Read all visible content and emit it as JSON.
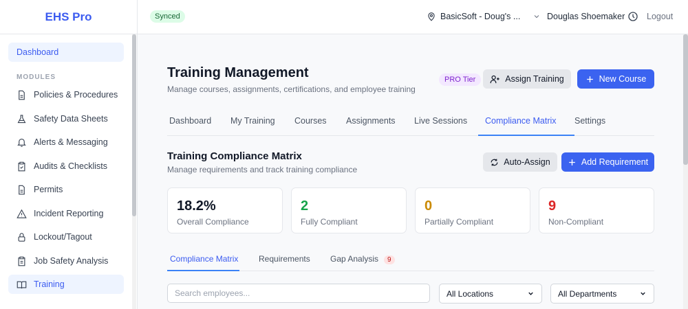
{
  "sidebar": {
    "logo": "EHS Pro",
    "dashboard": "Dashboard",
    "modules_label": "MODULES",
    "items": [
      {
        "label": "Policies & Procedures"
      },
      {
        "label": "Safety Data Sheets"
      },
      {
        "label": "Alerts & Messaging"
      },
      {
        "label": "Audits & Checklists"
      },
      {
        "label": "Permits"
      },
      {
        "label": "Incident Reporting"
      },
      {
        "label": "Lockout/Tagout"
      },
      {
        "label": "Job Safety Analysis"
      },
      {
        "label": "Training"
      }
    ]
  },
  "header": {
    "status": "Synced",
    "location": "BasicSoft - Doug's ...",
    "user": "Douglas Shoemaker",
    "logout": "Logout"
  },
  "page": {
    "title": "Training Management",
    "subtitle": "Manage courses, assignments, certifications, and employee training",
    "tier": "PRO Tier",
    "assign": "Assign Training",
    "new_course": "New Course",
    "tabs": [
      "Dashboard",
      "My Training",
      "Courses",
      "Assignments",
      "Live Sessions",
      "Compliance Matrix",
      "Settings"
    ]
  },
  "section": {
    "title": "Training Compliance Matrix",
    "subtitle": "Manage requirements and track training compliance",
    "auto_assign": "Auto-Assign",
    "add_requirement": "Add Requirement"
  },
  "stats": [
    {
      "value": "18.2%",
      "label": "Overall Compliance",
      "color": "#111827"
    },
    {
      "value": "2",
      "label": "Fully Compliant",
      "color": "#16a34a"
    },
    {
      "value": "0",
      "label": "Partially Compliant",
      "color": "#ca8a04"
    },
    {
      "value": "9",
      "label": "Non-Compliant",
      "color": "#dc2626"
    }
  ],
  "subtabs": {
    "matrix": "Compliance Matrix",
    "requirements": "Requirements",
    "gap": "Gap Analysis",
    "gap_count": "9"
  },
  "filters": {
    "search_placeholder": "Search employees...",
    "location": "All Locations",
    "department": "All Departments"
  }
}
